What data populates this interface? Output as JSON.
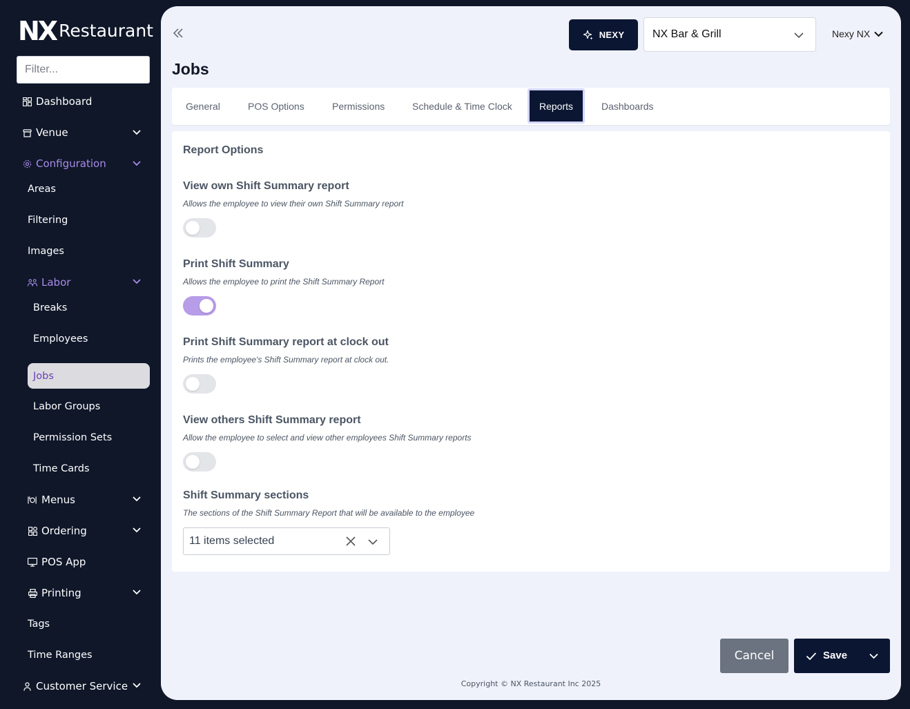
{
  "brand": {
    "mark": "NX",
    "name": "Restaurant"
  },
  "sidebar": {
    "filter_placeholder": "Filter...",
    "items": [
      {
        "label": "Dashboard"
      },
      {
        "label": "Venue"
      },
      {
        "label": "Configuration"
      },
      {
        "label": "Areas"
      },
      {
        "label": "Filtering"
      },
      {
        "label": "Images"
      },
      {
        "label": "Labor"
      },
      {
        "label": "Breaks"
      },
      {
        "label": "Employees"
      },
      {
        "label": "Jobs"
      },
      {
        "label": "Labor Groups"
      },
      {
        "label": "Permission Sets"
      },
      {
        "label": "Time Cards"
      },
      {
        "label": "Menus"
      },
      {
        "label": "Ordering"
      },
      {
        "label": "POS App"
      },
      {
        "label": "Printing"
      },
      {
        "label": "Tags"
      },
      {
        "label": "Time Ranges"
      },
      {
        "label": "Customer Service"
      }
    ]
  },
  "header": {
    "nexy_label": "NEXY",
    "venue": "NX Bar & Grill",
    "user": "Nexy NX"
  },
  "page": {
    "title": "Jobs"
  },
  "tabs": [
    {
      "label": "General"
    },
    {
      "label": "POS Options"
    },
    {
      "label": "Permissions"
    },
    {
      "label": "Schedule & Time Clock"
    },
    {
      "label": "Reports"
    },
    {
      "label": "Dashboards"
    }
  ],
  "report_options": {
    "title": "Report Options",
    "options": [
      {
        "title": "View own Shift Summary report",
        "desc": "Allows the employee to view their own Shift Summary report",
        "enabled": false
      },
      {
        "title": "Print Shift Summary",
        "desc": "Allows the employee to print the Shift Summary Report",
        "enabled": true
      },
      {
        "title": "Print Shift Summary report at clock out",
        "desc": "Prints the employee's Shift Summary report at clock out.",
        "enabled": false
      },
      {
        "title": "View others Shift Summary report",
        "desc": "Allow the employee to select and view other employees Shift Summary reports",
        "enabled": false
      }
    ],
    "sections": {
      "title": "Shift Summary sections",
      "desc": "The sections of the Shift Summary Report that will be available to the employee",
      "value": "11 items selected"
    }
  },
  "actions": {
    "cancel": "Cancel",
    "save": "Save"
  },
  "footer": {
    "copyright": "Copyright © NX Restaurant Inc 2025"
  },
  "colors": {
    "sidebar_bg": "#0f1729",
    "accent": "#a98be6",
    "primary": "#0b1633",
    "toggle_on": "#b79ce8"
  }
}
